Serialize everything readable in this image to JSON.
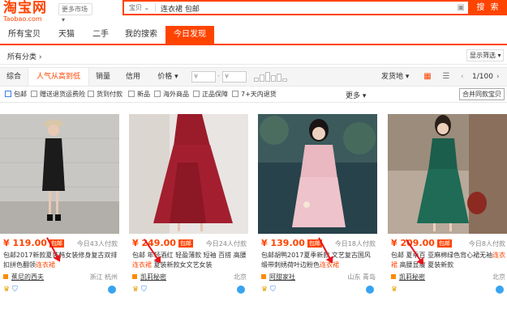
{
  "logo": {
    "main": "淘宝网",
    "sub": "Taobao.com"
  },
  "header": {
    "market": "更多市场",
    "search_category": "宝贝",
    "query": "连衣裙 包邮",
    "search_button": "搜 索"
  },
  "tabs": [
    "所有宝贝",
    "天猫",
    "二手",
    "我的搜索",
    "今日发现"
  ],
  "filter": {
    "label": "所有分类",
    "display_filter": "显示筛选"
  },
  "sort": {
    "options": [
      "综合",
      "人气从高到低",
      "销量",
      "信用",
      "价格"
    ],
    "price_from": "¥",
    "price_to": "¥",
    "ship_from": "发货地",
    "page": "1/100"
  },
  "checks": [
    "包邮",
    "赠送退货运费险",
    "货到付款",
    "新品",
    "海外商品",
    "正品保障",
    "7+天内退货"
  ],
  "more": "更多",
  "merge": "合并同款宝贝",
  "products": [
    {
      "price": "¥ 119.00",
      "badge": "包邮",
      "paid": "今日43人付款",
      "title_a": "包邮2017新款夏装韩女装修身复古",
      "title_b": "双排扣拼色翻领",
      "keyword": "连衣裙",
      "title_c": "",
      "shop": "蕉尼的西夫",
      "location": "浙江 杭州"
    },
    {
      "price": "¥ 249.00",
      "badge": "包邮",
      "paid": "今日24人付款",
      "title_a": "包邮 年轻酒红 轻盈薄款 短袖 百搭 高腰",
      "title_b": "",
      "keyword": "连衣裙",
      "title_c": " 夏装新款女文艺女装",
      "shop": "凯莉秘密",
      "location": "北京"
    },
    {
      "price": "¥ 139.00",
      "badge": "包邮",
      "paid": "今日18人付款",
      "title_a": "包邮胡鸭2017夏季新款 文艺复古国风",
      "title_b": "缎带刺绣荷叶边粉色",
      "keyword": "连衣裙",
      "title_c": "",
      "shop": "阿甜家社",
      "location": "山东 青岛"
    },
    {
      "price": "¥ 209.00",
      "badge": "包邮",
      "paid": "今日8人付款",
      "title_a": "包邮 夏季百 亚麻棉绿色背心裙无袖",
      "title_b": "",
      "keyword": "连衣裙",
      "title_c": " 高腰显瘦 夏装新款",
      "shop": "凯莉秘密",
      "location": "北京"
    }
  ]
}
